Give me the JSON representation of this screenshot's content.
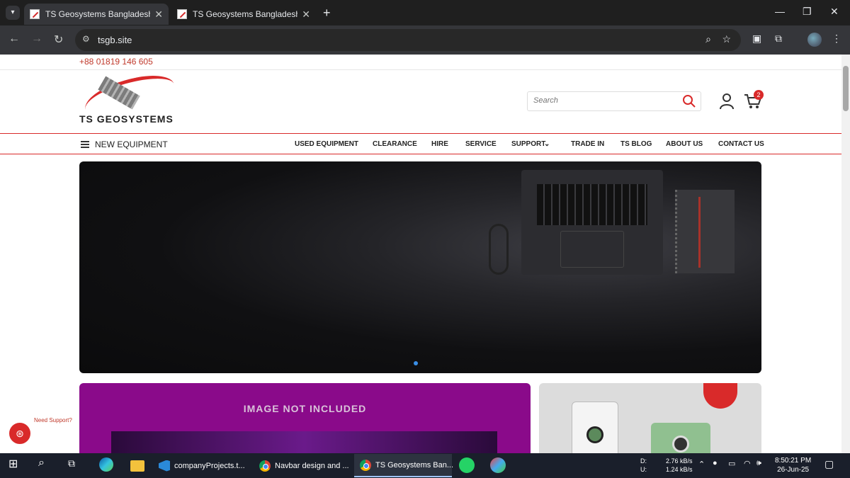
{
  "browser": {
    "tabs": [
      {
        "title": "TS Geosystems Bangladesh",
        "active": true
      },
      {
        "title": "TS Geosystems Bangladesh",
        "active": false
      }
    ],
    "url": "tsgb.site"
  },
  "site": {
    "phone": "+88 01819 146 605",
    "logo_text": "TS GEOSYSTEMS",
    "search_placeholder": "Search",
    "cart_count": "2",
    "new_equipment": "NEW EQUIPMENT",
    "menu": [
      "USED EQUIPMENT",
      "CLEARANCE",
      "HIRE",
      "SERVICE",
      "SUPPORT",
      "TRADE IN",
      "TS BLOG",
      "ABOUT US",
      "CONTACT US"
    ],
    "promo_text": "IMAGE NOT INCLUDED",
    "support_label": "Need Support?"
  },
  "taskbar": {
    "apps": [
      "companyProjects.t...",
      "Navbar design and ...",
      "TS Geosystems Ban..."
    ],
    "net_labels": [
      "D:",
      "U:"
    ],
    "net_values": [
      "2.76 kB/s",
      "1.24 kB/s"
    ],
    "time": "8:50:21 PM",
    "date": "26-Jun-25"
  },
  "colors": {
    "brand_red": "#d92a2a",
    "promo_purple": "#8a0a8a",
    "chrome_dark": "#202124"
  }
}
